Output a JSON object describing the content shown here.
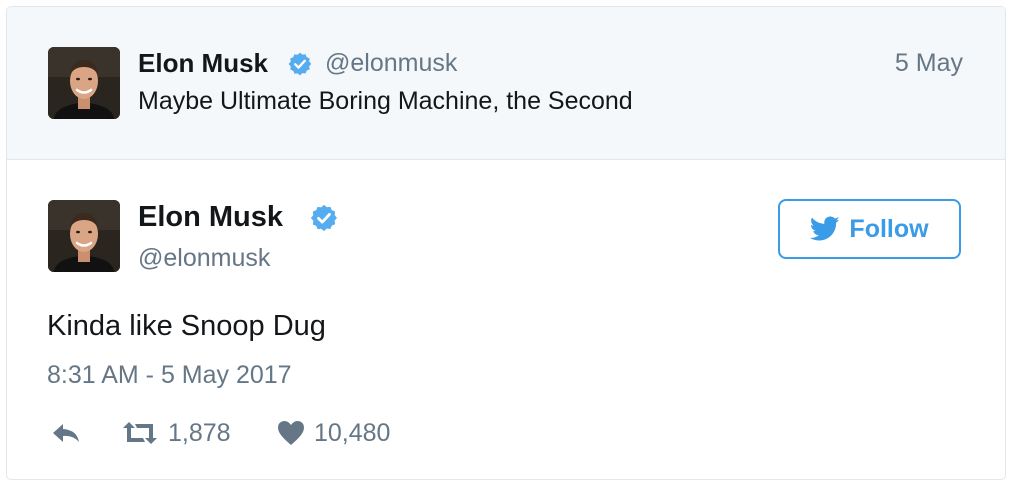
{
  "colors": {
    "accent": "#3a9be6",
    "verified": "#55acee",
    "text_primary": "#14171a",
    "text_secondary": "#657786",
    "parent_background": "#f5f8fa",
    "border": "#e1e8ed"
  },
  "parent_tweet": {
    "author_name": "Elon Musk",
    "verified_icon": "verified-badge-icon",
    "handle": "@elonmusk",
    "date": "5 May",
    "text": "Maybe Ultimate Boring Machine, the Second"
  },
  "main_tweet": {
    "author_name": "Elon Musk",
    "verified_icon": "verified-badge-icon",
    "handle": "@elonmusk",
    "follow_button": {
      "icon": "twitter-bird-icon",
      "label": "Follow"
    },
    "text": "Kinda like Snoop Dug",
    "timestamp": "8:31 AM - 5 May 2017",
    "actions": {
      "reply_icon": "reply-icon",
      "retweet_icon": "retweet-icon",
      "retweet_count": "1,878",
      "like_icon": "heart-icon",
      "like_count": "10,480"
    }
  }
}
